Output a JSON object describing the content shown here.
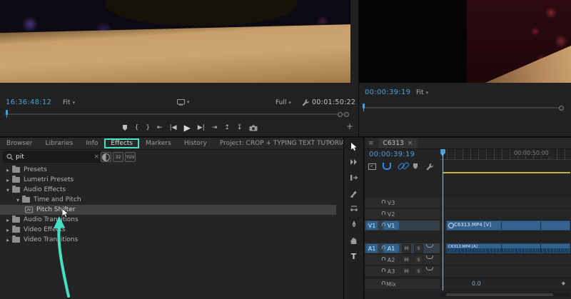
{
  "colors": {
    "accent_blue": "#2d8ceb",
    "timecode_blue": "#4aa0dc",
    "annotation_teal": "#45e0c4",
    "clip_blue": "#35618f",
    "render_bar_yellow": "#c0b23e"
  },
  "icons": {
    "chevron_right": "▸",
    "chevron_down": "▾",
    "caret_down": "▾",
    "close": "×",
    "overflow": "»",
    "menu": "≡",
    "plus": "+",
    "diamond": "◆",
    "bit32": "32",
    "yuv": "YUV"
  },
  "source_monitor": {
    "current_timecode": "16:36:48:12",
    "fit_label": "Fit",
    "resolution_label": "Full",
    "duration_timecode": "00:01:50:22"
  },
  "program_monitor": {
    "current_timecode": "00:00:39:19",
    "fit_label": "Fit"
  },
  "transport": {
    "mark_in": "{",
    "mark_out": "}",
    "go_to_in": "⇤",
    "step_back": "|◀",
    "play": "▶",
    "step_forward": "▶|",
    "go_to_out": "⇥",
    "lift": "↥",
    "extract": "↧"
  },
  "project_panel": {
    "tabs": [
      {
        "label": "Browser"
      },
      {
        "label": "Libraries"
      },
      {
        "label": "Info"
      },
      {
        "label": "Effects",
        "active": true
      },
      {
        "label": "Markers"
      },
      {
        "label": "History"
      },
      {
        "label": "Project: CROP + TYPING TEXT TUTORIAL"
      }
    ],
    "search_value": "pit",
    "tree": [
      {
        "label": "Presets"
      },
      {
        "label": "Lumetri Presets"
      },
      {
        "label": "Audio Effects",
        "expanded": true
      },
      {
        "label": "Time and Pitch",
        "expanded": true
      },
      {
        "label": "Pitch Shifter",
        "selected": true
      },
      {
        "label": "Audio Transitions"
      },
      {
        "label": "Video Effects"
      },
      {
        "label": "Video Transitions"
      }
    ]
  },
  "tools": {
    "type_label": "T"
  },
  "timeline": {
    "tab_label": "C6313",
    "current_timecode": "00:00:39:19",
    "ruler_label": "00:00:50:00",
    "tracks": {
      "video": [
        {
          "name": "V3"
        },
        {
          "name": "V2"
        },
        {
          "name": "V1",
          "patch": "V1",
          "targeted": true
        }
      ],
      "audio": [
        {
          "name": "A1",
          "patch": "A1",
          "targeted": true
        },
        {
          "name": "A2"
        },
        {
          "name": "A3"
        }
      ],
      "mute_label": "M",
      "solo_label": "S",
      "mix_label": "Mix",
      "mix_value": "0.0"
    },
    "clips": {
      "video_label": "C6313.MP4 [V]",
      "audio_label": "C6313.MP4 [A]"
    }
  }
}
